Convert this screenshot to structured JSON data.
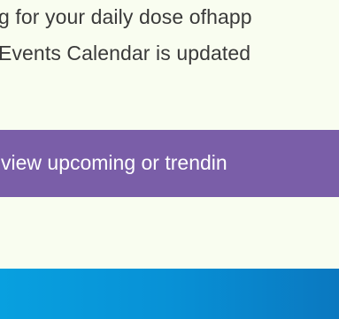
{
  "intro": {
    "line1": "g for your daily dose ofhapp",
    "line2": "Events Calendar is updated"
  },
  "cta": {
    "label": "view upcoming or trendin"
  },
  "colors": {
    "background": "#f9fdf0",
    "cta_background": "#7a5ea8",
    "footer_band_start": "#08a0df",
    "footer_band_end": "#0a78c0"
  }
}
